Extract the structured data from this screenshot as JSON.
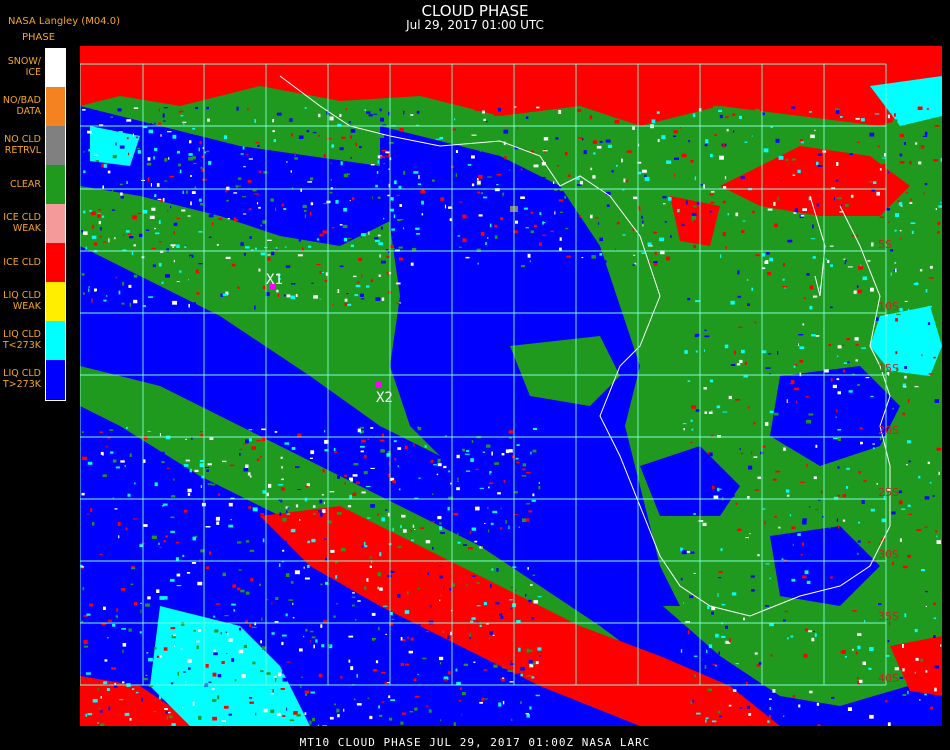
{
  "header": {
    "credit": "NASA Langley (M04.0)",
    "legend_title": "PHASE",
    "title": "CLOUD PHASE",
    "subtitle": "Jul 29, 2017 01:00 UTC"
  },
  "legend": [
    {
      "label": "SNOW/\nICE",
      "color": "#ffffff"
    },
    {
      "label": "NO/BAD\nDATA",
      "color": "#f58220"
    },
    {
      "label": "NO CLD\nRETRVL",
      "color": "#808080"
    },
    {
      "label": "CLEAR",
      "color": "#1f9a1f"
    },
    {
      "label": "ICE CLD\nWEAK",
      "color": "#f59a9a"
    },
    {
      "label": "ICE CLD",
      "color": "#ff0000"
    },
    {
      "label": "LIQ CLD\nWEAK",
      "color": "#ffee00"
    },
    {
      "label": "LIQ CLD\nT<273K",
      "color": "#00ffff"
    },
    {
      "label": "LIQ CLD\nT>273K",
      "color": "#0000ff"
    }
  ],
  "map": {
    "markers": [
      {
        "label": "X1",
        "color": "#ff00ff"
      },
      {
        "label": "X2",
        "color": "#ff00ff"
      }
    ],
    "lat_labels": [
      "5S",
      "10S",
      "15S",
      "20S",
      "25S",
      "30S",
      "35S",
      "40S"
    ],
    "grid_color": "#7fffd4",
    "coast_color": "#ffffff",
    "lat_label_color": "#cc2222"
  },
  "footer": "MT10  CLOUD PHASE   JUL 29, 2017 01:00Z   NASA LARC"
}
